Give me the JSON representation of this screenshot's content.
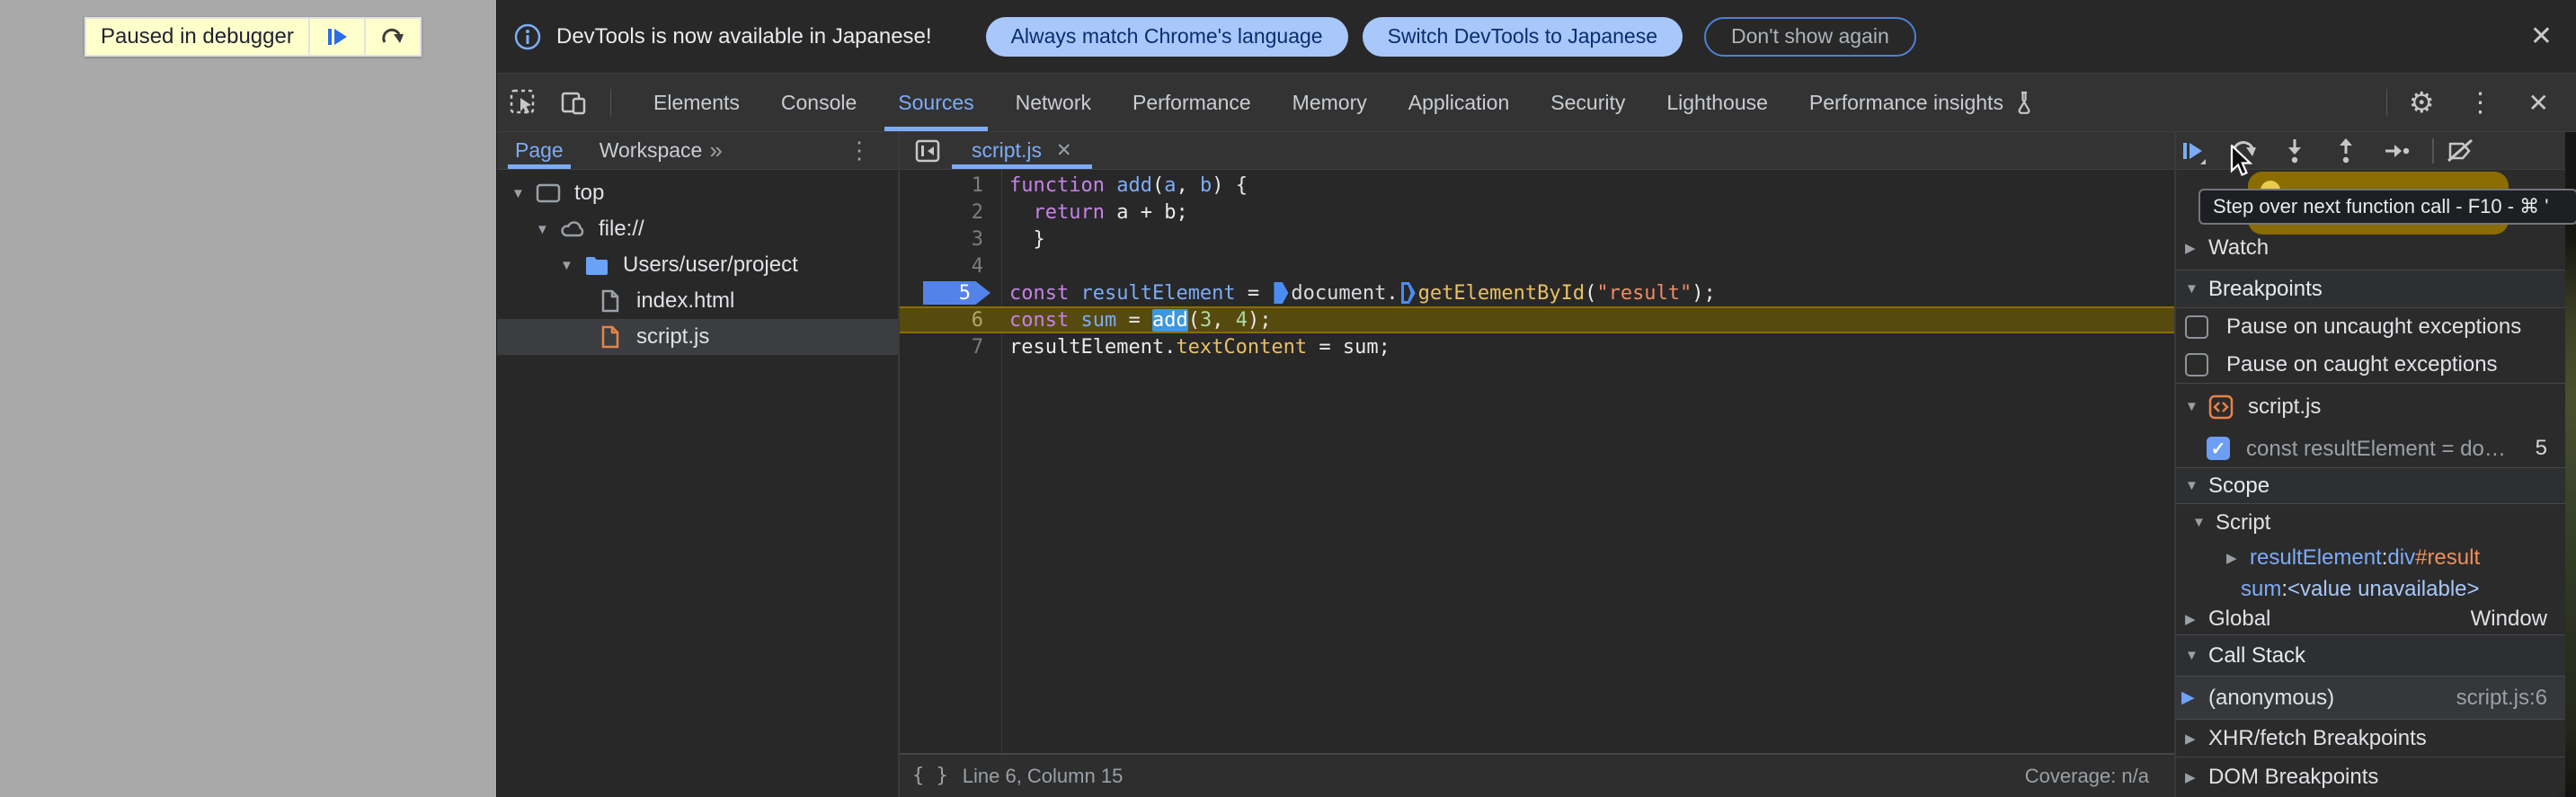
{
  "page": {
    "paused_toast": {
      "label": "Paused in debugger",
      "resume_icon": "resume-script-icon",
      "step_icon": "step-over-icon"
    }
  },
  "banner": {
    "info_icon": "info-icon",
    "message": "DevTools is now available in Japanese!",
    "actions": [
      "Always match Chrome's language",
      "Switch DevTools to Japanese"
    ],
    "dismiss": "Don't show again",
    "close": "✕"
  },
  "tabbar": {
    "active": "Sources",
    "tabs": [
      {
        "label": "Elements"
      },
      {
        "label": "Console"
      },
      {
        "label": "Sources"
      },
      {
        "label": "Network"
      },
      {
        "label": "Performance"
      },
      {
        "label": "Memory"
      },
      {
        "label": "Application"
      },
      {
        "label": "Security"
      },
      {
        "label": "Lighthouse"
      },
      {
        "label": "Performance insights",
        "flask": true
      }
    ],
    "gear": "⚙",
    "kebab": "⋮",
    "close": "✕"
  },
  "nav": {
    "tabs": [
      "Page",
      "Workspace"
    ],
    "active": "Page",
    "overflow": "»",
    "kebab": "⋮",
    "tree": [
      {
        "label": "top",
        "icon": "frame",
        "depth": 0,
        "expanded": true
      },
      {
        "label": "file://",
        "icon": "cloud",
        "depth": 1,
        "expanded": true
      },
      {
        "label": "Users/user/project",
        "icon": "folder",
        "depth": 2,
        "expanded": true
      },
      {
        "label": "index.html",
        "icon": "file-html",
        "depth": 3
      },
      {
        "label": "script.js",
        "icon": "file-js",
        "depth": 3,
        "selected": true
      }
    ]
  },
  "editor": {
    "tab": "script.js",
    "tab_close": "✕",
    "lines": [
      {
        "num": "1",
        "tokens": [
          {
            "t": "function ",
            "c": "kw"
          },
          {
            "t": "add",
            "c": "def"
          },
          {
            "t": "(",
            "c": "pln"
          },
          {
            "t": "a",
            "c": "def"
          },
          {
            "t": ", ",
            "c": "pln"
          },
          {
            "t": "b",
            "c": "def"
          },
          {
            "t": ") {",
            "c": "pln"
          }
        ]
      },
      {
        "num": "2",
        "tokens": [
          {
            "t": "  ",
            "c": "pln"
          },
          {
            "t": "return",
            "c": "kw"
          },
          {
            "t": " a + b;",
            "c": "pln"
          }
        ]
      },
      {
        "num": "3",
        "tokens": [
          {
            "t": "  }",
            "c": "pln"
          }
        ]
      },
      {
        "num": "4",
        "tokens": []
      },
      {
        "num": "5",
        "breakpoint": true,
        "tokens": [
          {
            "t": "const ",
            "c": "kw"
          },
          {
            "t": "resultElement",
            "c": "def"
          },
          {
            "t": " = ",
            "c": "pln"
          },
          {
            "m": "filled"
          },
          {
            "t": "document",
            "c": "obj"
          },
          {
            "t": ".",
            "c": "pln"
          },
          {
            "m": "hollow"
          },
          {
            "t": "getElementById",
            "c": "fn"
          },
          {
            "t": "(",
            "c": "pln"
          },
          {
            "t": "\"result\"",
            "c": "str"
          },
          {
            "t": ");",
            "c": "pln"
          }
        ]
      },
      {
        "num": "6",
        "current": true,
        "tokens": [
          {
            "t": "const ",
            "c": "kw"
          },
          {
            "t": "sum",
            "c": "def"
          },
          {
            "t": " = ",
            "c": "pln"
          },
          {
            "t": "add",
            "c": "sel"
          },
          {
            "t": "(",
            "c": "pln"
          },
          {
            "t": "3",
            "c": "num"
          },
          {
            "t": ", ",
            "c": "pln"
          },
          {
            "t": "4",
            "c": "num"
          },
          {
            "t": ");",
            "c": "pln"
          }
        ]
      },
      {
        "num": "7",
        "tokens": [
          {
            "t": "resultElement.",
            "c": "pln"
          },
          {
            "t": "textContent",
            "c": "fn"
          },
          {
            "t": " = sum;",
            "c": "pln"
          }
        ]
      }
    ],
    "status": {
      "icon": "{ }",
      "position": "Line 6, Column 15",
      "coverage": "Coverage: n/a"
    }
  },
  "debugger_panel": {
    "toolbar": [
      "resume",
      "step-over",
      "step-into",
      "step-out",
      "step",
      "deactivate-breakpoints"
    ],
    "tooltip": "Step over next function call - F10 - ⌘ '",
    "watch": {
      "title": "Watch"
    },
    "breakpoints": {
      "title": "Breakpoints",
      "options": [
        "Pause on uncaught exceptions",
        "Pause on caught exceptions"
      ],
      "group": {
        "file": "script.js",
        "entry": {
          "code": "const resultElement = doc⋯",
          "line": "5",
          "checked": true
        }
      }
    },
    "scope": {
      "title": "Scope",
      "section": "Script",
      "variables": [
        {
          "name": "resultElement",
          "sep": ": ",
          "value_tag": "div",
          "value_id": "#result"
        },
        {
          "name": "sum",
          "sep": ": ",
          "value": "<value unavailable>"
        }
      ],
      "global": {
        "name": "Global",
        "value": "Window"
      }
    },
    "call_stack": {
      "title": "Call Stack",
      "frames": [
        {
          "name": "(anonymous)",
          "location": "script.js:6"
        }
      ]
    },
    "xhr_breakpoints": {
      "title": "XHR/fetch Breakpoints"
    },
    "dom_breakpoints": {
      "title": "DOM Breakpoints"
    }
  },
  "colors": {
    "accent": "#7cacf8",
    "paused_line_bg": "#564a0f",
    "paused_line_border": "#8a6d00",
    "breakpoint_blue": "#5383e8",
    "keyword": "#c582e8",
    "string": "#f08b63",
    "property": "#e9c062",
    "number": "#aed9a8",
    "orange_file": "#e8834a",
    "toast_bg": "#ffffcc",
    "pill_bg": "#a8c7fa"
  }
}
